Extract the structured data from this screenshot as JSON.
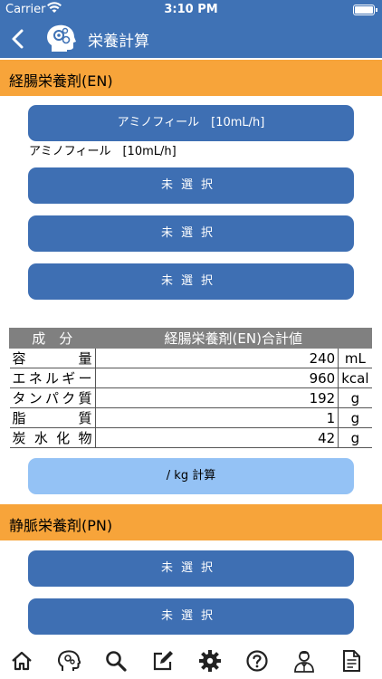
{
  "status": {
    "carrier": "Carrier",
    "time": "3:10 PM"
  },
  "nav": {
    "title": "栄養計算"
  },
  "en": {
    "header": "経腸栄養剤(EN)",
    "buttons": [
      "アミノフィール　[10mL/h]",
      "未選択",
      "未選択",
      "未選択"
    ],
    "selected_label": "アミノフィール　[10mL/h]"
  },
  "table": {
    "headers": [
      "成　分",
      "経腸栄養剤(EN)合計値"
    ],
    "rows": [
      {
        "name": "容量",
        "value": "240",
        "unit": "mL"
      },
      {
        "name": "エネルギー",
        "value": "960",
        "unit": "kcal"
      },
      {
        "name": "タンパク質",
        "value": "192",
        "unit": "g"
      },
      {
        "name": "脂質",
        "value": "1",
        "unit": "g"
      },
      {
        "name": "炭水化物",
        "value": "42",
        "unit": "g"
      }
    ]
  },
  "calc_button": "/ kg 計算",
  "pn": {
    "header": "静脈栄養剤(PN)",
    "buttons": [
      "未選択",
      "未選択"
    ]
  },
  "tabs": [
    "home-icon",
    "brain-icon",
    "search-icon",
    "edit-icon",
    "gear-icon",
    "help-icon",
    "doctor-icon",
    "document-icon"
  ]
}
